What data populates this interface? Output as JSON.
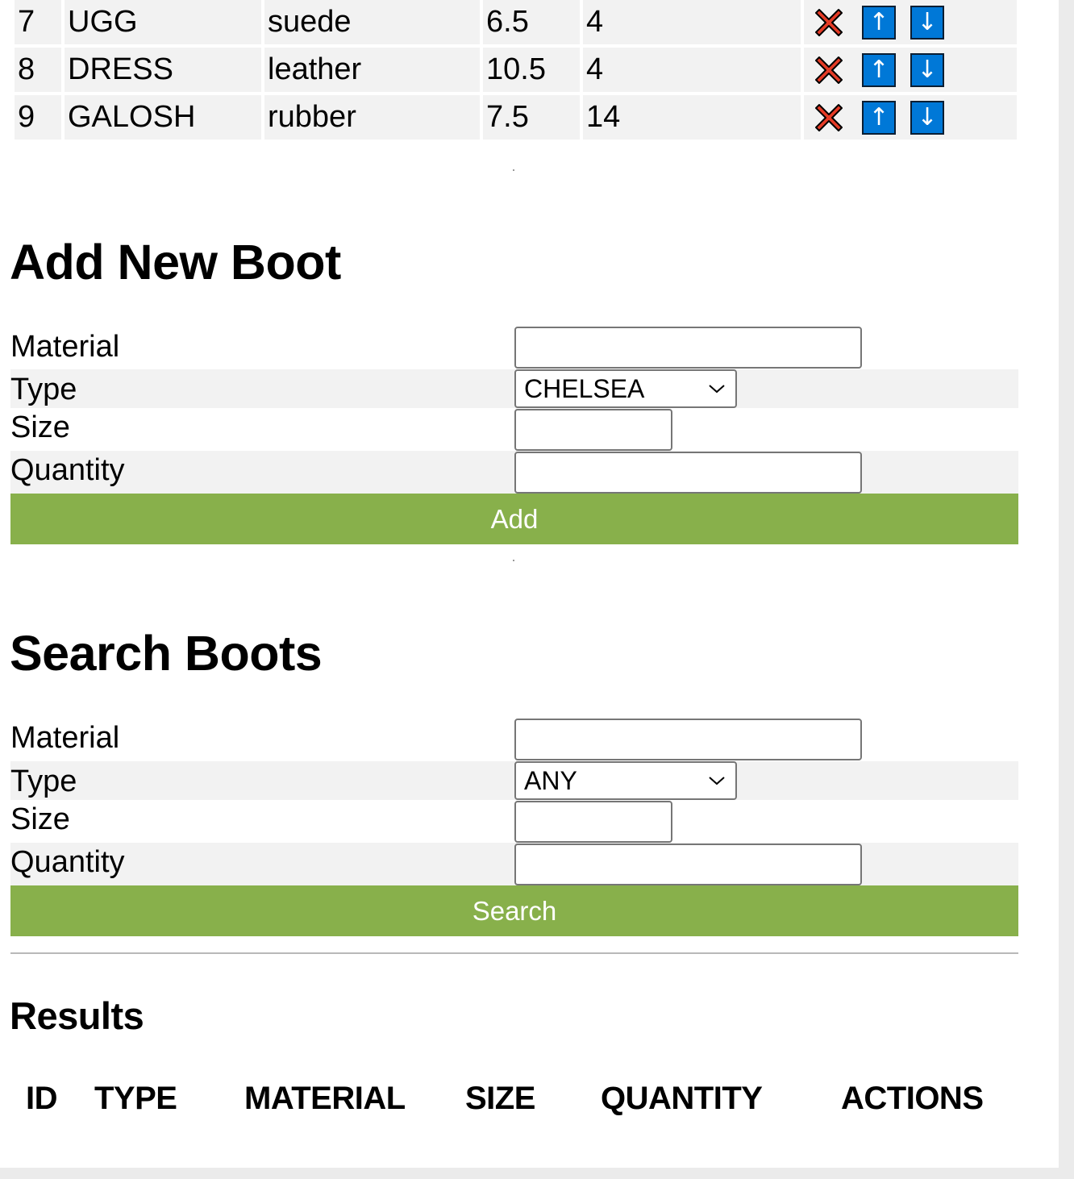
{
  "inventory": {
    "rows": [
      {
        "id": "7",
        "type": "UGG",
        "material": "suede",
        "size": "6.5",
        "quantity": "4"
      },
      {
        "id": "8",
        "type": "DRESS",
        "material": "leather",
        "size": "10.5",
        "quantity": "4"
      },
      {
        "id": "9",
        "type": "GALOSH",
        "material": "rubber",
        "size": "7.5",
        "quantity": "14"
      }
    ],
    "actions": {
      "delete_icon": "red-x-icon",
      "up_icon": "arrow-up-icon",
      "up_glyph": "↑",
      "down_icon": "arrow-down-icon",
      "down_glyph": "↓"
    },
    "colors": {
      "delete": "#e53b26",
      "arrow_bg": "#0078d7"
    }
  },
  "add_form": {
    "title": "Add New Boot",
    "material_label": "Material",
    "type_label": "Type",
    "type_value": "CHELSEA",
    "size_label": "Size",
    "quantity_label": "Quantity",
    "button_label": "Add"
  },
  "search_form": {
    "title": "Search Boots",
    "material_label": "Material",
    "type_label": "Type",
    "type_value": "ANY",
    "size_label": "Size",
    "quantity_label": "Quantity",
    "button_label": "Search"
  },
  "results": {
    "title": "Results",
    "headers": [
      "ID",
      "TYPE",
      "MATERIAL",
      "SIZE",
      "QUANTITY",
      "ACTIONS"
    ]
  },
  "colors": {
    "button_green": "#88b04b",
    "row_shade": "#f2f2f2"
  }
}
